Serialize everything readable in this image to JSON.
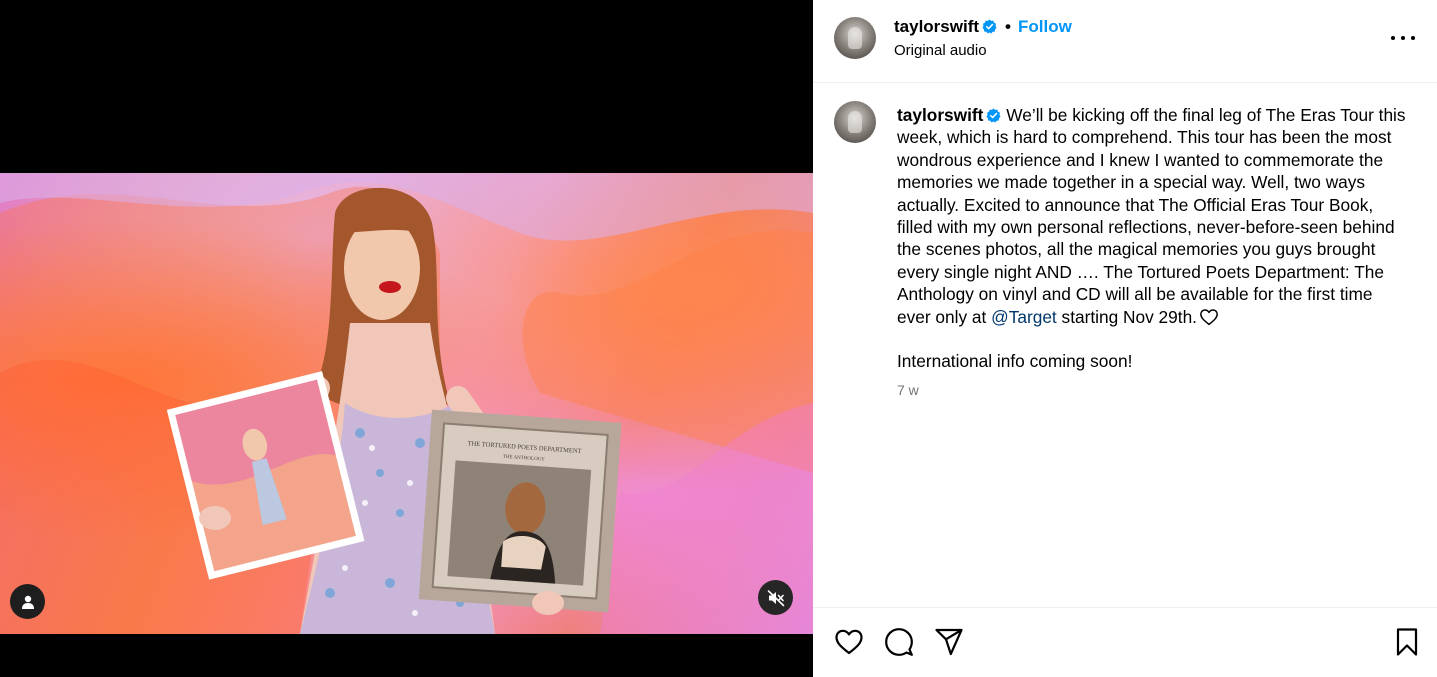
{
  "post": {
    "username": "taylorswift",
    "follow_label": "Follow",
    "separator": "•",
    "audio_label": "Original audio",
    "caption_username": "taylorswift",
    "caption_text_before_mention": "We’ll be kicking off the final leg of The Eras Tour this week, which is hard to comprehend. This tour has been the most wondrous experience and I knew I wanted to commemorate the memories we made together in a special way. Well, two ways actually. Excited to announce that The Official Eras Tour Book, filled with my own personal reflections, never-before-seen behind the scenes photos, all the magical memories you guys brought every single night AND …. The Tortured Poets Department: The Anthology on vinyl and CD will all be available for the first time ever only at",
    "mention": "@Target",
    "caption_text_after_mention": "starting Nov 29th.",
    "caption_second_paragraph": "International info coming soon!",
    "time_ago": "7 w"
  },
  "media": {
    "album_cover_text": "THE TORTURED POETS DEPARTMENT",
    "album_cover_subtext": "THE ANTHOLOGY"
  },
  "icons": {
    "verified": "verified-badge-icon",
    "more": "more-options-icon",
    "like": "heart-icon",
    "comment": "comment-icon",
    "share": "share-icon",
    "save": "bookmark-icon",
    "user_tag": "user-icon",
    "mute": "muted-speaker-icon"
  },
  "colors": {
    "accent": "#0095f6",
    "mention": "#00376b",
    "muted_text": "#737373",
    "verified": "#0095f6"
  }
}
